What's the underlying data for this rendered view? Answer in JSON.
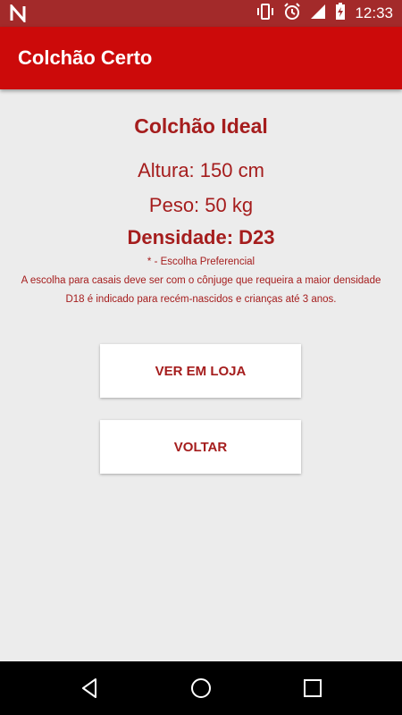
{
  "status_bar": {
    "time": "12:33",
    "left_icon": "n-logo-icon",
    "right_icons": [
      "vibrate-icon",
      "alarm-icon",
      "signal-icon",
      "battery-charging-icon"
    ]
  },
  "app_bar": {
    "title": "Colchão Certo"
  },
  "result": {
    "heading": "Colchão Ideal",
    "altura": "Altura: 150 cm",
    "peso": "Peso: 50 kg",
    "densidade": "Densidade: D23",
    "note_preferencial": "* - Escolha Preferencial",
    "note_casais": "A escolha para casais deve ser com o cônjuge que requeira a maior densidade",
    "note_d18": "D18 é indicado para recém-nascidos e crianças até 3 anos."
  },
  "buttons": {
    "ver_em_loja": "VER EM LOJA",
    "voltar": "VOLTAR"
  },
  "nav_bar": {
    "icons": [
      "back-icon",
      "home-icon",
      "recents-icon"
    ]
  },
  "colors": {
    "status_bar": "#a32a2a",
    "app_bar": "#cc0a0a",
    "text_accent": "#a51d1d",
    "background": "#ececec"
  }
}
